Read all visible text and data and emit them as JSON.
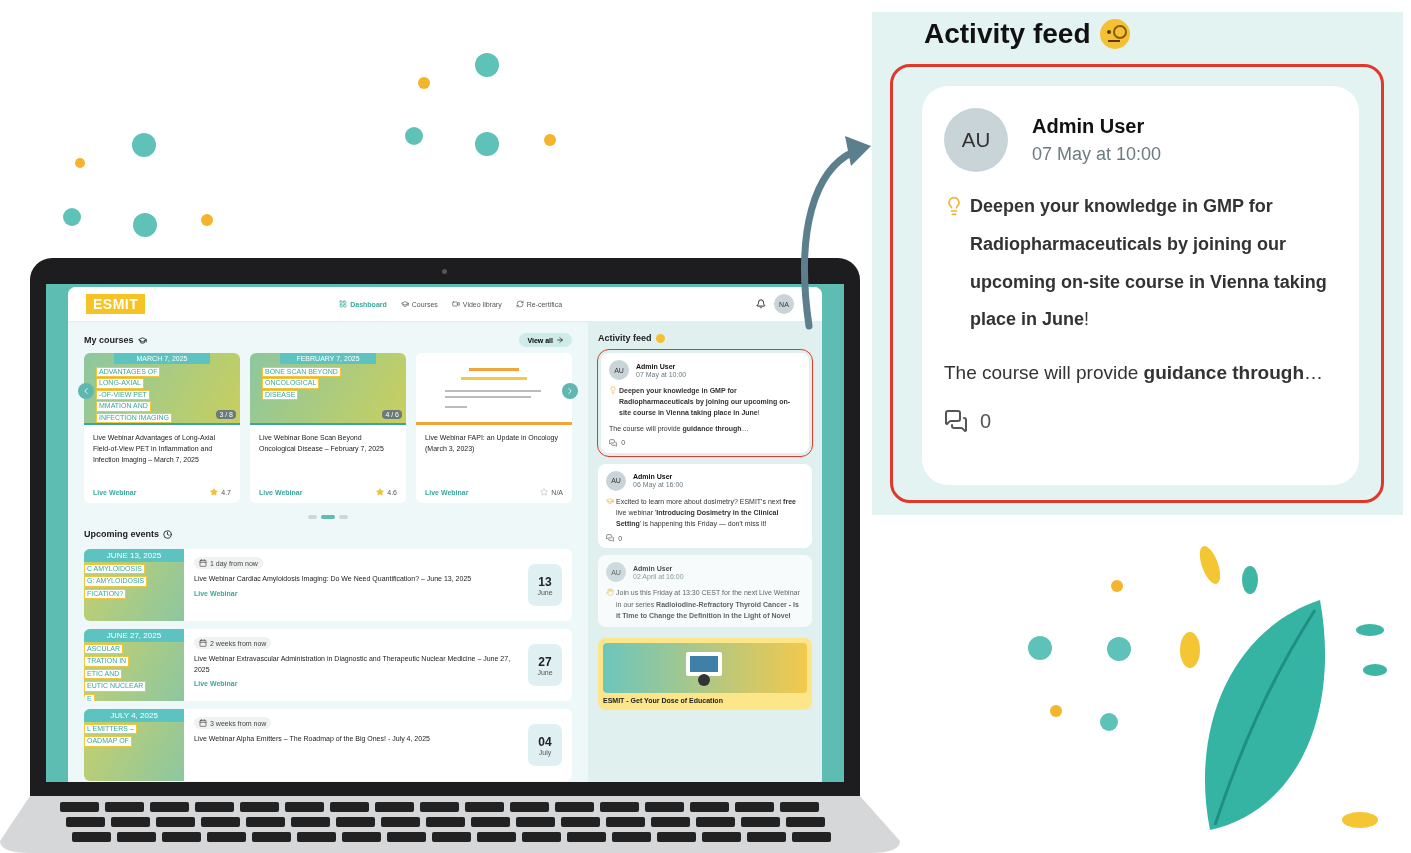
{
  "app": {
    "logo": "ESMIT",
    "nav": [
      {
        "label": "Dashboard",
        "selected": true
      },
      {
        "label": "Courses",
        "selected": false
      },
      {
        "label": "Video library",
        "selected": false
      },
      {
        "label": "Re-certifica",
        "selected": false
      }
    ],
    "avatar": "NA",
    "courses": {
      "title": "My courses",
      "view_all": "View all",
      "items": [
        {
          "kind": "banner",
          "date": "MARCH 7, 2025",
          "banner": [
            "ADVANTAGES OF",
            "LONG-AXIAL",
            "-OF-VIEW PET",
            "MMATION AND",
            "INFECTION IMAGING"
          ],
          "count": "3 / 8",
          "title": "Live Webinar Advantages of Long-Axial Field-of-View PET in Inflammation and Infection Imaging – March 7, 2025",
          "type": "Live Webinar",
          "rated": true,
          "rating": "4.7"
        },
        {
          "kind": "banner",
          "date": "FEBRUARY 7, 2025",
          "banner": [
            "BONE SCAN BEYOND",
            "ONCOLOGICAL",
            "DISEASE"
          ],
          "count": "4 / 6",
          "title": "Live Webinar Bone Scan Beyond Oncological Disease – February 7, 2025",
          "type": "Live Webinar",
          "rated": true,
          "rating": "4.6"
        },
        {
          "kind": "slide",
          "title": "Live Webinar FAPI: an Update in Oncology (March 3, 2023)",
          "type": "Live Webinar",
          "rated": false,
          "rating": "N/A"
        }
      ],
      "pager": [
        {
          "selected": false
        },
        {
          "selected": true
        },
        {
          "selected": false
        }
      ]
    },
    "events": {
      "title": "Upcoming events",
      "items": [
        {
          "date": "JUNE 13, 2025",
          "banner": [
            "C AMYLOIDOSIS",
            "G: AMYLOIDOSIS",
            "FICATION?"
          ],
          "when": "1 day from now",
          "title": "Live Webinar Cardiac Amyloidosis Imaging: Do We Need Quantification? – June 13, 2025",
          "type": "Live Webinar",
          "day": "13",
          "month": "June"
        },
        {
          "date": "JUNE 27, 2025",
          "banner": [
            "ASCULAR",
            "TRATION IN",
            "ETIC AND",
            "EUTIC NUCLEAR",
            "E"
          ],
          "when": "2 weeks from now",
          "title": "Live Webinar Extravascular Administration in Diagnostic and Therapeutic Nuclear Medicine – June 27, 2025",
          "type": "Live Webinar",
          "day": "27",
          "month": "June"
        },
        {
          "date": "JULY 4, 2025",
          "banner": [
            "L EMITTERS –",
            "OADMAP OF"
          ],
          "when": "3 weeks from now",
          "title": "Live Webinar Alpha Emitters – The Roadmap of the Big Ones! - July 4, 2025",
          "day": "04",
          "month": "July"
        }
      ]
    },
    "feed": {
      "title": "Activity feed",
      "posts": [
        {
          "avatar": "AU",
          "author": "Admin User",
          "time": "07 May at 10:00",
          "body": "**Deepen your knowledge in GMP for Radiopharmaceuticals by joining our upcoming on-site course in Vienna taking place in June**!",
          "excerpt": "The course will provide **guidance through**…",
          "comments": "0",
          "highlighted": true,
          "faded": false
        },
        {
          "avatar": "AU",
          "author": "Admin User",
          "time": "06 May at 16:00",
          "body": "Excited to learn more about dosimetry? ESMIT's next **free** live webinar '**Introducing Dosimetry in the Clinical Setting**' is happening this Friday — don't miss it!",
          "comments": "0",
          "highlighted": false,
          "faded": false
        },
        {
          "avatar": "AU",
          "author": "Admin User",
          "time": "02 April at 16:00",
          "body": "Join us this Friday at 13:30 CEST for the next Live Webinar in our series **Radioiodine-Refractory Thyroid Cancer - Is it Time to Change the Definition in the Light of Novel**",
          "highlighted": false,
          "faded": true
        }
      ],
      "promo": "ESMIT - Get Your Dose of Education"
    }
  },
  "callout": {
    "title": "Activity feed",
    "post": {
      "avatar": "AU",
      "author": "Admin User",
      "time": "07 May at 10:00",
      "body": "**Deepen your knowledge in GMP for Radiopharmaceuticals by joining our upcoming on-site course in Vienna taking place in June**!",
      "excerpt": "The course will provide **guidance through**…",
      "comments": "0",
      "highlighted": true
    }
  }
}
